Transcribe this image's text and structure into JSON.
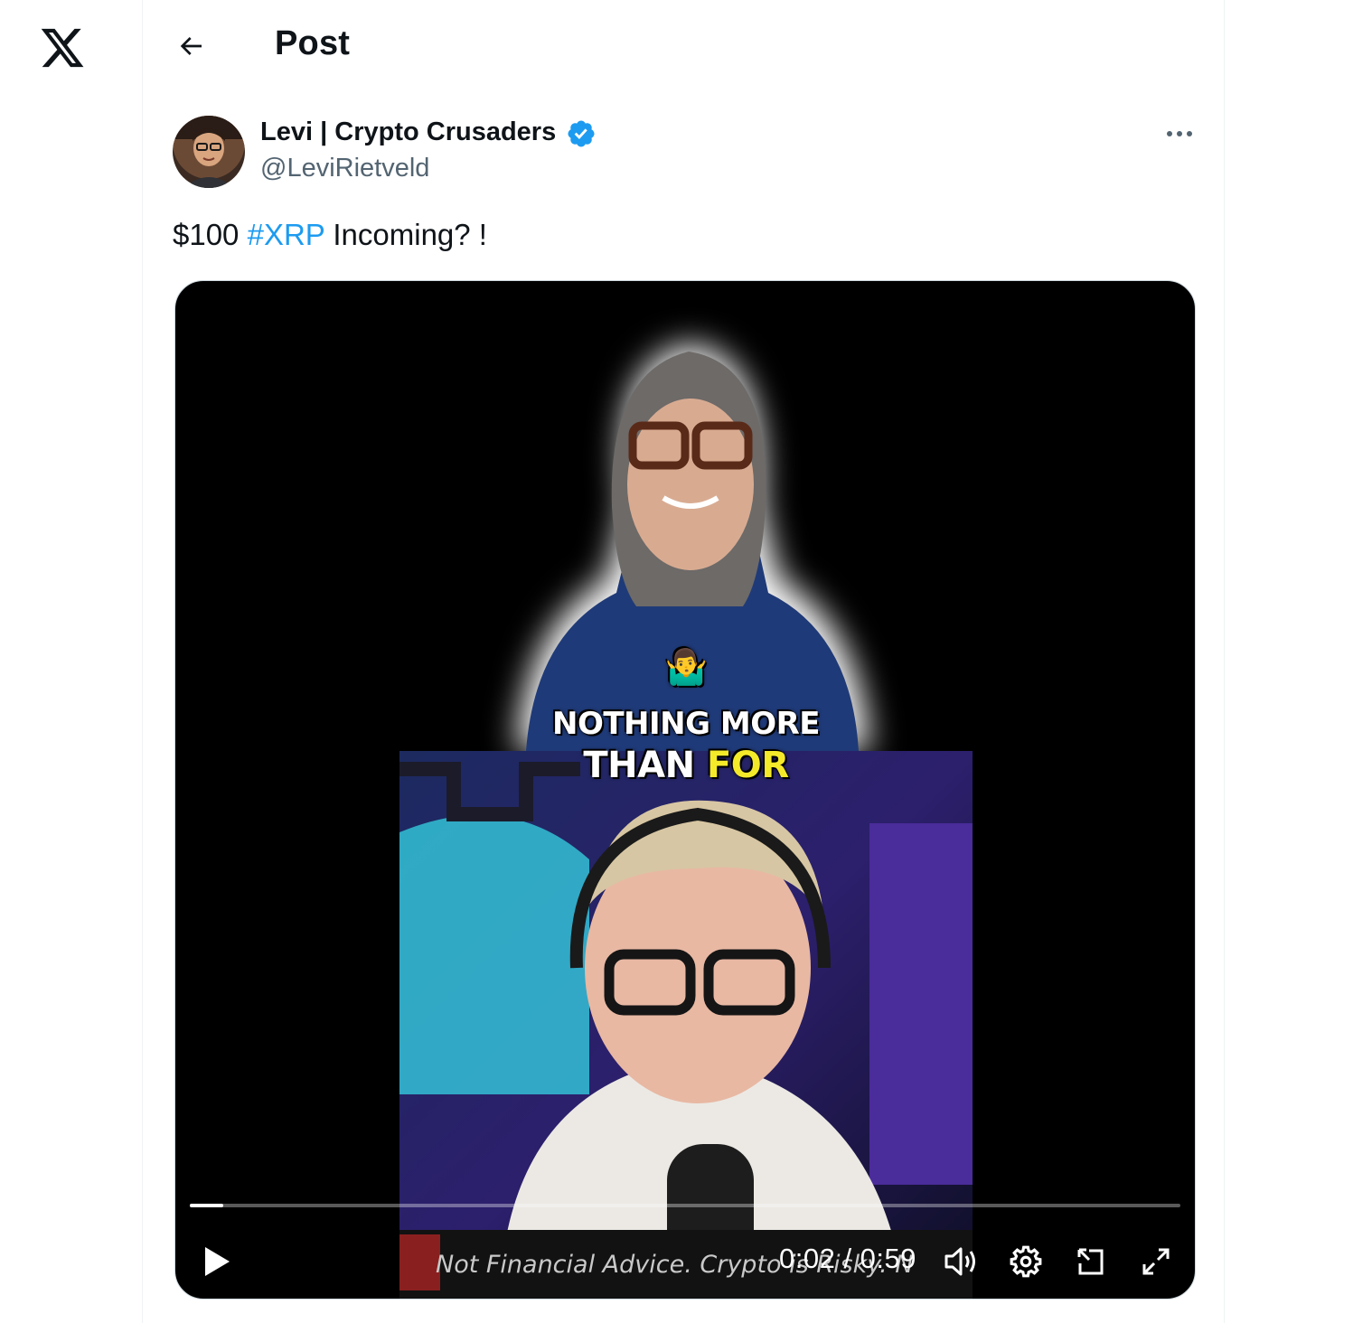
{
  "nav": {
    "logo_icon": "x-logo-icon"
  },
  "header": {
    "title": "Post",
    "back_icon": "arrow-left-icon"
  },
  "post": {
    "author_name": "Levi | Crypto Crusaders",
    "handle": "@LeviRietveld",
    "verified": true,
    "text_prefix": "$100 ",
    "hashtag": "#XRP",
    "text_suffix": " Incoming? !"
  },
  "video": {
    "caption_line1": "NOTHING MORE",
    "caption_line2_white": "THAN ",
    "caption_line2_yellow": "FOR",
    "banner_text": "Not Financial Advice. Crypto is Risky. N",
    "current_time": "0:02",
    "duration": "0:59",
    "time_display": "0:02 / 0:59",
    "progress": 0.034,
    "colors": {
      "caption_yellow": "#f4ea2a",
      "accent": "#1d9bf0"
    }
  }
}
